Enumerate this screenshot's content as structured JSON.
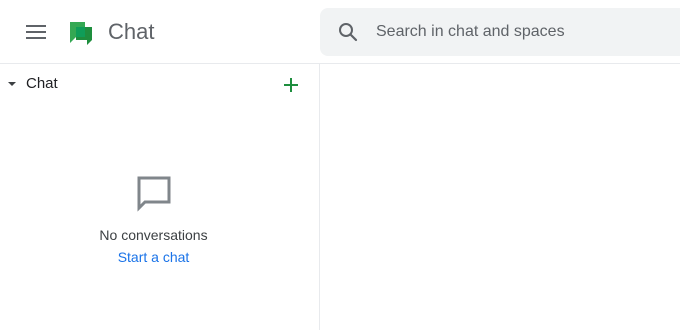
{
  "header": {
    "menu_icon": "hamburger-menu-icon",
    "logo_icon": "google-chat-logo",
    "app_title": "Chat",
    "search": {
      "icon": "search-icon",
      "placeholder": "Search in chat and spaces",
      "value": ""
    }
  },
  "sidebar": {
    "section": {
      "caret_icon": "caret-down-icon",
      "title": "Chat",
      "add_icon": "plus-icon"
    },
    "empty_state": {
      "icon": "chat-bubble-icon",
      "message": "No conversations",
      "link_label": "Start a chat"
    }
  },
  "colors": {
    "accent_green": "#1e8e3e",
    "link_blue": "#1a73e8",
    "search_bg": "#f1f3f4",
    "icon_gray": "#5f6368"
  }
}
